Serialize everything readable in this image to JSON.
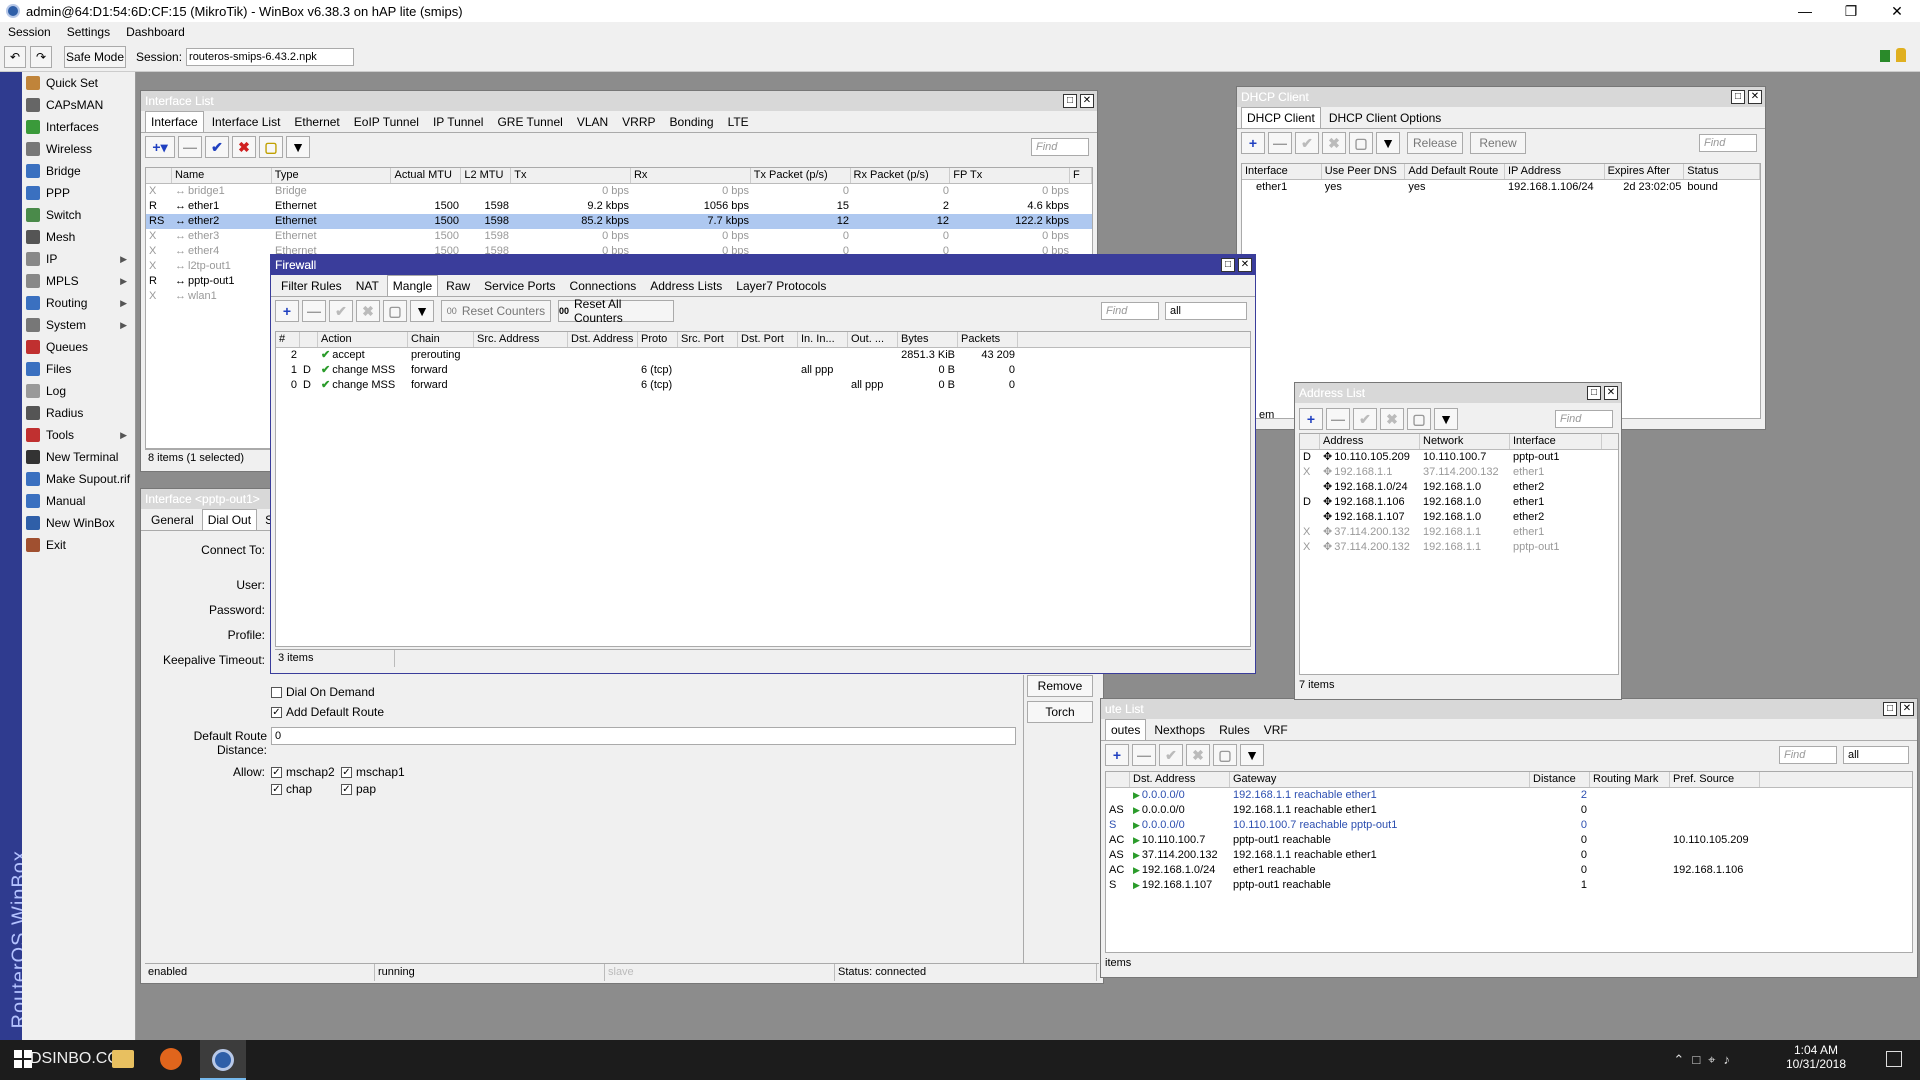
{
  "app": {
    "title": "admin@64:D1:54:6D:CF:15 (MikroTik) - WinBox v6.38.3 on hAP lite (smips)",
    "menu": [
      "Session",
      "Settings",
      "Dashboard"
    ],
    "safe_mode": "Safe Mode",
    "session_label": "Session:",
    "session_value": "routeros-smips-6.43.2.npk",
    "brand": "RouterOS WinBox"
  },
  "sidebar": [
    {
      "label": "Quick Set",
      "icon": "quick-set-icon",
      "color": "#c0843a",
      "sub": false
    },
    {
      "label": "CAPsMAN",
      "icon": "capsman-icon",
      "color": "#666666",
      "sub": false
    },
    {
      "label": "Interfaces",
      "icon": "interfaces-icon",
      "color": "#3a9a3a",
      "sub": false
    },
    {
      "label": "Wireless",
      "icon": "wireless-icon",
      "color": "#777777",
      "sub": false
    },
    {
      "label": "Bridge",
      "icon": "bridge-icon",
      "color": "#3a70c0",
      "sub": false
    },
    {
      "label": "PPP",
      "icon": "ppp-icon",
      "color": "#3a70c0",
      "sub": false
    },
    {
      "label": "Switch",
      "icon": "switch-icon",
      "color": "#4a8a4a",
      "sub": false
    },
    {
      "label": "Mesh",
      "icon": "mesh-icon",
      "color": "#555555",
      "sub": false
    },
    {
      "label": "IP",
      "icon": "ip-icon",
      "color": "#888888",
      "sub": true
    },
    {
      "label": "MPLS",
      "icon": "mpls-icon",
      "color": "#888888",
      "sub": true
    },
    {
      "label": "Routing",
      "icon": "routing-icon",
      "color": "#3a70c0",
      "sub": true
    },
    {
      "label": "System",
      "icon": "system-icon",
      "color": "#777777",
      "sub": true
    },
    {
      "label": "Queues",
      "icon": "queues-icon",
      "color": "#c03030",
      "sub": false
    },
    {
      "label": "Files",
      "icon": "files-icon",
      "color": "#3a70c0",
      "sub": false
    },
    {
      "label": "Log",
      "icon": "log-icon",
      "color": "#999999",
      "sub": false
    },
    {
      "label": "Radius",
      "icon": "radius-icon",
      "color": "#555555",
      "sub": false
    },
    {
      "label": "Tools",
      "icon": "tools-icon",
      "color": "#c03030",
      "sub": true
    },
    {
      "label": "New Terminal",
      "icon": "terminal-icon",
      "color": "#333333",
      "sub": false
    },
    {
      "label": "Make Supout.rif",
      "icon": "supout-icon",
      "color": "#3a70c0",
      "sub": false
    },
    {
      "label": "Manual",
      "icon": "manual-icon",
      "color": "#3a70c0",
      "sub": false
    },
    {
      "label": "New WinBox",
      "icon": "winbox-icon",
      "color": "#2f5fa8",
      "sub": false
    },
    {
      "label": "Exit",
      "icon": "exit-icon",
      "color": "#a05030",
      "sub": false
    }
  ],
  "iface": {
    "title": "Interface List",
    "tabs": [
      "Interface",
      "Interface List",
      "Ethernet",
      "EoIP Tunnel",
      "IP Tunnel",
      "GRE Tunnel",
      "VLAN",
      "VRRP",
      "Bonding",
      "LTE"
    ],
    "find": "Find",
    "columns": [
      "Name",
      "Type",
      "Actual MTU",
      "L2 MTU",
      "Tx",
      "Rx",
      "Tx Packet (p/s)",
      "Rx Packet (p/s)",
      "FP Tx",
      "F"
    ],
    "rows": [
      {
        "flag": "X",
        "name": "bridge1",
        "type": "Bridge",
        "mtu": "",
        "l2": "",
        "tx": "0 bps",
        "rx": "0 bps",
        "txp": "0",
        "rxp": "0",
        "fptx": "0 bps",
        "dis": true,
        "sel": false
      },
      {
        "flag": "R",
        "name": "ether1",
        "type": "Ethernet",
        "mtu": "1500",
        "l2": "1598",
        "tx": "9.2 kbps",
        "rx": "1056 bps",
        "txp": "15",
        "rxp": "2",
        "fptx": "4.6 kbps",
        "dis": false,
        "sel": false
      },
      {
        "flag": "RS",
        "name": "ether2",
        "type": "Ethernet",
        "mtu": "1500",
        "l2": "1598",
        "tx": "85.2 kbps",
        "rx": "7.7 kbps",
        "txp": "12",
        "rxp": "12",
        "fptx": "122.2 kbps",
        "dis": false,
        "sel": true
      },
      {
        "flag": "X",
        "name": "ether3",
        "type": "Ethernet",
        "mtu": "1500",
        "l2": "1598",
        "tx": "0 bps",
        "rx": "0 bps",
        "txp": "0",
        "rxp": "0",
        "fptx": "0 bps",
        "dis": true,
        "sel": false
      },
      {
        "flag": "X",
        "name": "ether4",
        "type": "Ethernet",
        "mtu": "1500",
        "l2": "1598",
        "tx": "0 bps",
        "rx": "0 bps",
        "txp": "0",
        "rxp": "0",
        "fptx": "0 bps",
        "dis": true,
        "sel": false
      },
      {
        "flag": "X",
        "name": "l2tp-out1",
        "type": "",
        "mtu": "",
        "l2": "",
        "tx": "",
        "rx": "",
        "txp": "",
        "rxp": "",
        "fptx": "",
        "dis": true,
        "sel": false
      },
      {
        "flag": "R",
        "name": "pptp-out1",
        "type": "",
        "mtu": "",
        "l2": "",
        "tx": "",
        "rx": "",
        "txp": "",
        "rxp": "",
        "fptx": "",
        "dis": false,
        "sel": false
      },
      {
        "flag": "X",
        "name": "wlan1",
        "type": "",
        "mtu": "",
        "l2": "",
        "tx": "",
        "rx": "",
        "txp": "",
        "rxp": "",
        "fptx": "",
        "dis": true,
        "sel": false
      }
    ],
    "status": "8 items (1 selected)"
  },
  "pptp": {
    "title": "Interface <pptp-out1>",
    "tabs": [
      "General",
      "Dial Out",
      "Stat"
    ],
    "connect_to": "Connect To:",
    "user": "User:",
    "password": "Password:",
    "profile": "Profile:",
    "keepalive": "Keepalive Timeout:",
    "dial_on_demand": "Dial On Demand",
    "add_default_route": "Add Default Route",
    "default_route_distance_label": "Default Route Distance:",
    "default_route_distance": "0",
    "allow": "Allow:",
    "mschap2": "mschap2",
    "mschap1": "mschap1",
    "chap": "chap",
    "pap": "pap",
    "remove": "Remove",
    "torch": "Torch",
    "status": [
      "enabled",
      "running",
      "slave",
      "Status: connected"
    ]
  },
  "firewall": {
    "title": "Firewall",
    "tabs": [
      "Filter Rules",
      "NAT",
      "Mangle",
      "Raw",
      "Service Ports",
      "Connections",
      "Address Lists",
      "Layer7 Protocols"
    ],
    "reset_counters": "Reset Counters",
    "reset_all_counters": "Reset All Counters",
    "find": "Find",
    "filter": "all",
    "columns": [
      "#",
      "Action",
      "Chain",
      "Src. Address",
      "Dst. Address",
      "Proto",
      "Src. Port",
      "Dst. Port",
      "In. In...",
      "Out. ...",
      "Bytes",
      "Packets"
    ],
    "rows": [
      {
        "num": "2",
        "flag": "",
        "action": "accept",
        "chain": "prerouting",
        "proto": "",
        "in": "",
        "out": "",
        "bytes": "2851.3 KiB",
        "packets": "43 209"
      },
      {
        "num": "1",
        "flag": "D",
        "action": "change MSS",
        "chain": "forward",
        "proto": "6 (tcp)",
        "in": "all ppp",
        "out": "",
        "bytes": "0 B",
        "packets": "0"
      },
      {
        "num": "0",
        "flag": "D",
        "action": "change MSS",
        "chain": "forward",
        "proto": "6 (tcp)",
        "in": "",
        "out": "all ppp",
        "bytes": "0 B",
        "packets": "0"
      }
    ],
    "status": "3 items"
  },
  "dhcp": {
    "title": "DHCP Client",
    "tabs": [
      "DHCP Client",
      "DHCP Client Options"
    ],
    "release": "Release",
    "renew": "Renew",
    "find": "Find",
    "columns": [
      "Interface",
      "Use Peer DNS",
      "Add Default Route",
      "IP Address",
      "Expires After",
      "Status"
    ],
    "row": {
      "iface": "ether1",
      "dns": "yes",
      "route": "yes",
      "ip": "192.168.1.106/24",
      "expires": "2d 23:02:05",
      "status": "bound"
    },
    "status": "em"
  },
  "addr": {
    "title": "Address List",
    "find": "Find",
    "columns": [
      "Address",
      "Network",
      "Interface"
    ],
    "rows": [
      {
        "flag": "D",
        "address": "10.110.105.209",
        "network": "10.110.100.7",
        "iface": "pptp-out1",
        "dis": false
      },
      {
        "flag": "X",
        "address": "192.168.1.1",
        "network": "37.114.200.132",
        "iface": "ether1",
        "dis": true
      },
      {
        "flag": "",
        "address": "192.168.1.0/24",
        "network": "192.168.1.0",
        "iface": "ether2",
        "dis": false
      },
      {
        "flag": "D",
        "address": "192.168.1.106",
        "network": "192.168.1.0",
        "iface": "ether1",
        "dis": false
      },
      {
        "flag": "",
        "address": "192.168.1.107",
        "network": "192.168.1.0",
        "iface": "ether2",
        "dis": false
      },
      {
        "flag": "X",
        "address": "37.114.200.132",
        "network": "192.168.1.1",
        "iface": "ether1",
        "dis": true
      },
      {
        "flag": "X",
        "address": "37.114.200.132",
        "network": "192.168.1.1",
        "iface": "pptp-out1",
        "dis": true
      }
    ],
    "status": "7 items"
  },
  "routes": {
    "title": "ute List",
    "tabs": [
      "outes",
      "Nexthops",
      "Rules",
      "VRF"
    ],
    "find": "Find",
    "filter": "all",
    "columns": [
      "Dst. Address",
      "Gateway",
      "Distance",
      "Routing Mark",
      "Pref. Source"
    ],
    "rows": [
      {
        "flag": "",
        "dst": "0.0.0.0/0",
        "gw": "192.168.1.1 reachable ether1",
        "dist": "2",
        "src": "",
        "blue": true
      },
      {
        "flag": "AS",
        "dst": "0.0.0.0/0",
        "gw": "192.168.1.1 reachable ether1",
        "dist": "0",
        "src": "",
        "blue": false
      },
      {
        "flag": "S",
        "dst": "0.0.0.0/0",
        "gw": "10.110.100.7 reachable pptp-out1",
        "dist": "0",
        "src": "",
        "blue": true
      },
      {
        "flag": "AC",
        "dst": "10.110.100.7",
        "gw": "pptp-out1 reachable",
        "dist": "0",
        "src": "10.110.105.209",
        "blue": false
      },
      {
        "flag": "AS",
        "dst": "37.114.200.132",
        "gw": "192.168.1.1 reachable ether1",
        "dist": "0",
        "src": "",
        "blue": false
      },
      {
        "flag": "AC",
        "dst": "192.168.1.0/24",
        "gw": "ether1 reachable",
        "dist": "0",
        "src": "192.168.1.106",
        "blue": false
      },
      {
        "flag": "S",
        "dst": "192.168.1.107",
        "gw": "pptp-out1 reachable",
        "dist": "1",
        "src": "",
        "blue": false
      }
    ],
    "status": "items"
  },
  "taskbar": {
    "time": "1:04 AM",
    "date": "10/31/2018",
    "watermark": "DSINBO.COM"
  }
}
